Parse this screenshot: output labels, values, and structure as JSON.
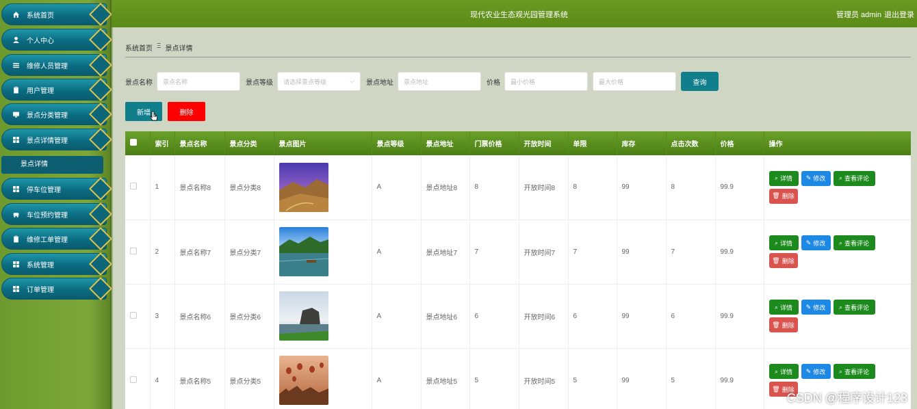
{
  "topbar": {
    "title": "现代农业生态观光园管理系统",
    "user": "管理员 admin",
    "logout": "退出登录"
  },
  "sidebar": {
    "items": [
      {
        "label": "系统首页",
        "icon": "home-icon"
      },
      {
        "label": "个人中心",
        "icon": "user-icon"
      },
      {
        "label": "维修人员管理",
        "icon": "list-icon"
      },
      {
        "label": "用户管理",
        "icon": "clipboard-icon"
      },
      {
        "label": "景点分类管理",
        "icon": "monitor-icon"
      },
      {
        "label": "景点详情管理",
        "icon": "grid-icon"
      },
      {
        "label": "停车位管理",
        "icon": "grid-icon"
      },
      {
        "label": "车位预约管理",
        "icon": "car-icon"
      },
      {
        "label": "维修工单管理",
        "icon": "clipboard-icon"
      },
      {
        "label": "系统管理",
        "icon": "grid-icon"
      },
      {
        "label": "订单管理",
        "icon": "grid-icon"
      }
    ],
    "submenu": "景点详情"
  },
  "breadcrumb": {
    "home": "系统首页",
    "separator": "Ξ",
    "current": "景点详情"
  },
  "search": {
    "name_label": "景点名称",
    "name_placeholder": "景点名称",
    "level_label": "景点等级",
    "level_placeholder": "请选择景点等级",
    "address_label": "景点地址",
    "address_placeholder": "景点地址",
    "price_label": "价格",
    "min_price_placeholder": "最小价格",
    "max_price_placeholder": "最大价格",
    "query_button": "查询"
  },
  "actions": {
    "add": "新增",
    "delete": "删除"
  },
  "table": {
    "headers": [
      "",
      "索引",
      "景点名称",
      "景点分类",
      "景点图片",
      "景点等级",
      "景点地址",
      "门票价格",
      "开放时间",
      "单限",
      "库存",
      "点击次数",
      "价格",
      "操作"
    ],
    "rows": [
      {
        "index": "1",
        "name": "景点名称8",
        "category": "景点分类8",
        "level": "A",
        "address": "景点地址8",
        "ticket": "8",
        "open": "开放时间8",
        "limit": "8",
        "stock": "99",
        "clicks": "8",
        "price": "99.9"
      },
      {
        "index": "2",
        "name": "景点名称7",
        "category": "景点分类7",
        "level": "A",
        "address": "景点地址7",
        "ticket": "7",
        "open": "开放时间7",
        "limit": "7",
        "stock": "99",
        "clicks": "7",
        "price": "99.9"
      },
      {
        "index": "3",
        "name": "景点名称6",
        "category": "景点分类6",
        "level": "A",
        "address": "景点地址6",
        "ticket": "6",
        "open": "开放时间6",
        "limit": "6",
        "stock": "99",
        "clicks": "6",
        "price": "99.9"
      },
      {
        "index": "4",
        "name": "景点名称5",
        "category": "景点分类5",
        "level": "A",
        "address": "景点地址5",
        "ticket": "5",
        "open": "开放时间5",
        "limit": "5",
        "stock": "99",
        "clicks": "5",
        "price": "99.9"
      }
    ],
    "ops": {
      "detail": "详情",
      "edit": "修改",
      "review": "查看评论",
      "delete": "删除"
    }
  },
  "watermark": "CSDN @程序设计123"
}
